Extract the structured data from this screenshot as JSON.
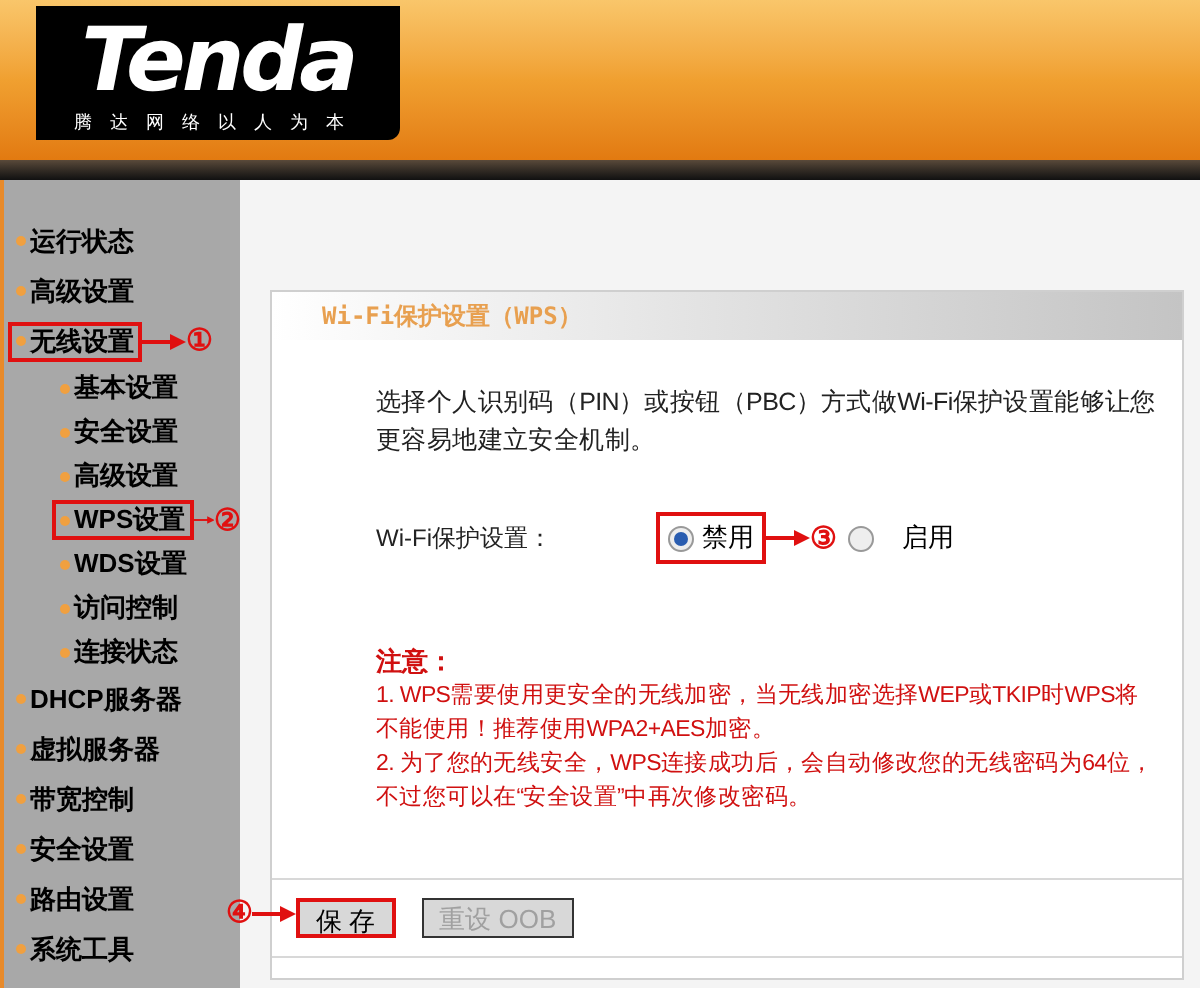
{
  "header": {
    "logo": "Tenda",
    "slogan": "腾达网络以人为本"
  },
  "sidebar": {
    "items": [
      {
        "label": "运行状态"
      },
      {
        "label": "高级设置"
      },
      {
        "label": "无线设置",
        "annotation": "①",
        "children": [
          {
            "label": "基本设置"
          },
          {
            "label": "安全设置"
          },
          {
            "label": "高级设置"
          },
          {
            "label": "WPS设置",
            "annotation": "②"
          },
          {
            "label": "WDS设置"
          },
          {
            "label": "访问控制"
          },
          {
            "label": "连接状态"
          }
        ]
      },
      {
        "label": "DHCP服务器"
      },
      {
        "label": "虚拟服务器"
      },
      {
        "label": "带宽控制"
      },
      {
        "label": "安全设置"
      },
      {
        "label": "路由设置"
      },
      {
        "label": "系统工具"
      }
    ]
  },
  "panel": {
    "title": "Wi-Fi保护设置（WPS）",
    "description": "选择个人识别码（PIN）或按钮（PBC）方式做Wi-Fi保护设置能够让您更容易地建立安全机制。",
    "setting": {
      "label": "Wi-Fi保护设置：",
      "options": [
        {
          "label": "禁用",
          "selected": true,
          "annotation": "③"
        },
        {
          "label": "启用",
          "selected": false
        }
      ]
    },
    "notice": {
      "heading": "注意：",
      "items": [
        "1. WPS需要使用更安全的无线加密，当无线加密选择WEP或TKIP时WPS将不能使用！推荐使用WPA2+AES加密。",
        "2. 为了您的无线安全，WPS连接成功后，会自动修改您的无线密码为64位，不过您可以在“安全设置”中再次修改密码。"
      ]
    },
    "buttons": [
      {
        "label": "保 存",
        "disabled": false,
        "annotation": "④"
      },
      {
        "label": "重设 OOB",
        "disabled": true
      }
    ]
  }
}
